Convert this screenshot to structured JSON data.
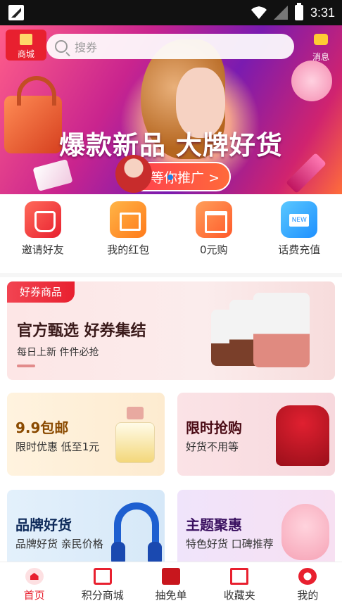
{
  "status_bar": {
    "time": "3:31"
  },
  "header": {
    "mall_label": "商城",
    "search_placeholder": "搜券",
    "message_label": "消息"
  },
  "banner": {
    "title": "爆款新品 大牌好货",
    "button_label": "等你推广 >"
  },
  "quick_actions": [
    {
      "label": "邀请好友",
      "icon": "gift-bag-icon"
    },
    {
      "label": "我的红包",
      "icon": "red-envelope-icon"
    },
    {
      "label": "0元购",
      "icon": "shop-icon"
    },
    {
      "label": "话费充值",
      "icon": "phone-recharge-icon"
    }
  ],
  "coupon_section": {
    "tag": "好券商品",
    "title": "官方甄选 好券集结",
    "subtitle": "每日上新 件件必抢"
  },
  "cards": [
    {
      "title": "9.9包邮",
      "subtitle": "限时优惠 低至1元"
    },
    {
      "title": "限时抢购",
      "subtitle": "好货不用等"
    },
    {
      "title": "品牌好货",
      "subtitle": "品牌好货 亲民价格"
    },
    {
      "title": "主题聚惠",
      "subtitle": "特色好货 口碑推荐"
    }
  ],
  "tabs": [
    {
      "label": "首页",
      "active": true
    },
    {
      "label": "积分商城",
      "active": false
    },
    {
      "label": "抽免单",
      "active": false
    },
    {
      "label": "收藏夹",
      "active": false
    },
    {
      "label": "我的",
      "active": false
    }
  ],
  "colors": {
    "accent": "#e8202f"
  }
}
